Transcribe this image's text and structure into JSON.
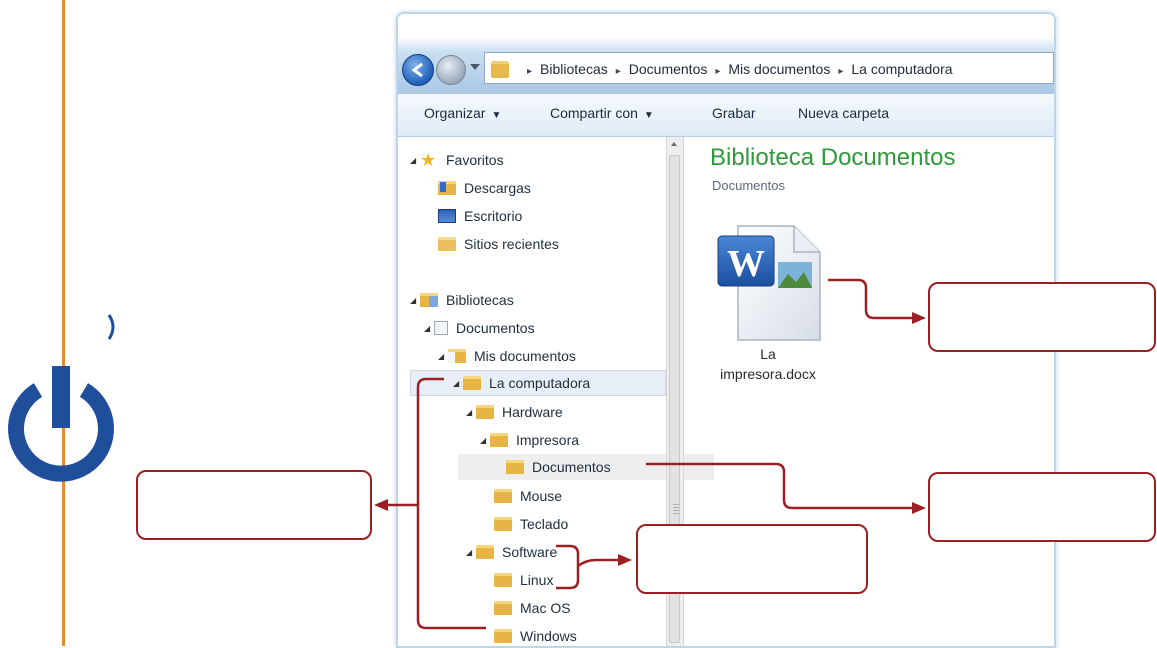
{
  "address_bar": {
    "crumbs": [
      "Bibliotecas",
      "Documentos",
      "Mis documentos",
      "La computadora"
    ]
  },
  "toolbar": {
    "organize_label": "Organizar",
    "share_label": "Compartir con",
    "burn_label": "Grabar",
    "new_folder_label": "Nueva carpeta"
  },
  "nav_tree": {
    "favorites": "Favoritos",
    "downloads": "Descargas",
    "desktop": "Escritorio",
    "recent": "Sitios recientes",
    "libraries": "Bibliotecas",
    "documents_lib": "Documentos",
    "my_documents": "Mis documentos",
    "computer": "La computadora",
    "hardware": "Hardware",
    "printer": "Impresora",
    "documents_sub": "Documentos",
    "mouse": "Mouse",
    "keyboard": "Teclado",
    "software": "Software",
    "linux": "Linux",
    "macos": "Mac OS",
    "windows": "Windows"
  },
  "content": {
    "title": "Biblioteca Documentos",
    "subtitle": "Documentos",
    "file_line1": "La",
    "file_line2": "impresora.docx",
    "file_badge": "W"
  },
  "icons": {
    "power": "power-icon",
    "word_doc": "word-document-icon",
    "star": "star-icon",
    "folder": "folder-icon"
  },
  "colors": {
    "accent_orange": "#e8892f",
    "power_blue": "#1f4f9b",
    "callout_red": "#9b1f23",
    "title_green": "#2f9a3a"
  }
}
